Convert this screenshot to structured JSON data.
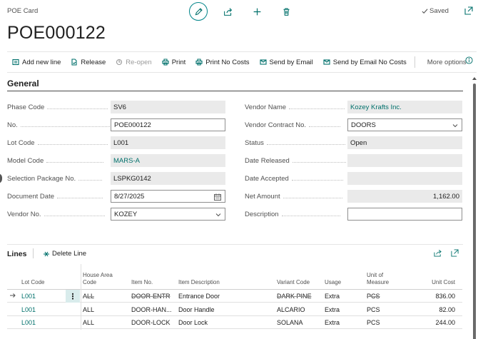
{
  "page": {
    "kind": "POE Card",
    "title": "POE000122",
    "status": "Saved"
  },
  "actions": {
    "add_new_line": "Add new line",
    "release": "Release",
    "reopen": "Re-open",
    "print": "Print",
    "print_no_costs": "Print No Costs",
    "send_by_email": "Send by Email",
    "send_by_email_no_costs": "Send by Email No Costs",
    "more_options": "More options"
  },
  "general": {
    "title": "General",
    "phase_code": {
      "label": "Phase Code",
      "value": "SV6"
    },
    "no": {
      "label": "No.",
      "value": "POE000122"
    },
    "lot_code": {
      "label": "Lot Code",
      "value": "L001"
    },
    "model_code": {
      "label": "Model Code",
      "value": "MARS-A"
    },
    "selection_package_no": {
      "label": "Selection Package No.",
      "value": "LSPKG0142"
    },
    "document_date": {
      "label": "Document Date",
      "value": "8/27/2025"
    },
    "vendor_no": {
      "label": "Vendor No.",
      "value": "KOZEY"
    },
    "vendor_name": {
      "label": "Vendor Name",
      "value": "Kozey Krafts Inc."
    },
    "vendor_contract_no": {
      "label": "Vendor Contract No.",
      "value": "DOORS"
    },
    "status": {
      "label": "Status",
      "value": "Open"
    },
    "date_released": {
      "label": "Date Released",
      "value": ""
    },
    "date_accepted": {
      "label": "Date Accepted",
      "value": ""
    },
    "net_amount": {
      "label": "Net Amount",
      "value": "1,162.00"
    },
    "description": {
      "label": "Description",
      "value": ""
    }
  },
  "lines": {
    "title": "Lines",
    "delete_line": "Delete Line",
    "columns": {
      "lot_code": "Lot Code",
      "house_area_code": "House Area Code",
      "item_no": "Item No.",
      "item_description": "Item Description",
      "variant_code": "Variant Code",
      "usage": "Usage",
      "unit_of_measure": "Unit of Measure",
      "unit_cost": "Unit Cost"
    },
    "rows": [
      {
        "lot_code": "L001",
        "house_area_code": "ALL",
        "item_no": "DOOR-ENTR",
        "item_description": "Entrance Door",
        "variant_code": "DARK PINE",
        "usage": "Extra",
        "unit_of_measure": "PCS",
        "unit_cost": "836.00"
      },
      {
        "lot_code": "L001",
        "house_area_code": "ALL",
        "item_no": "DOOR-HAN...",
        "item_description": "Door Handle",
        "variant_code": "ALCARIO",
        "usage": "Extra",
        "unit_of_measure": "PCS",
        "unit_cost": "82.00"
      },
      {
        "lot_code": "L001",
        "house_area_code": "ALL",
        "item_no": "DOOR-LOCK",
        "item_description": "Door Lock",
        "variant_code": "SOLANA",
        "usage": "Extra",
        "unit_of_measure": "PCS",
        "unit_cost": "244.00"
      }
    ]
  },
  "colors": {
    "accent": "#00706b",
    "readonly_bg": "#eaeaea",
    "row_menu_bg": "#d9ecec"
  }
}
